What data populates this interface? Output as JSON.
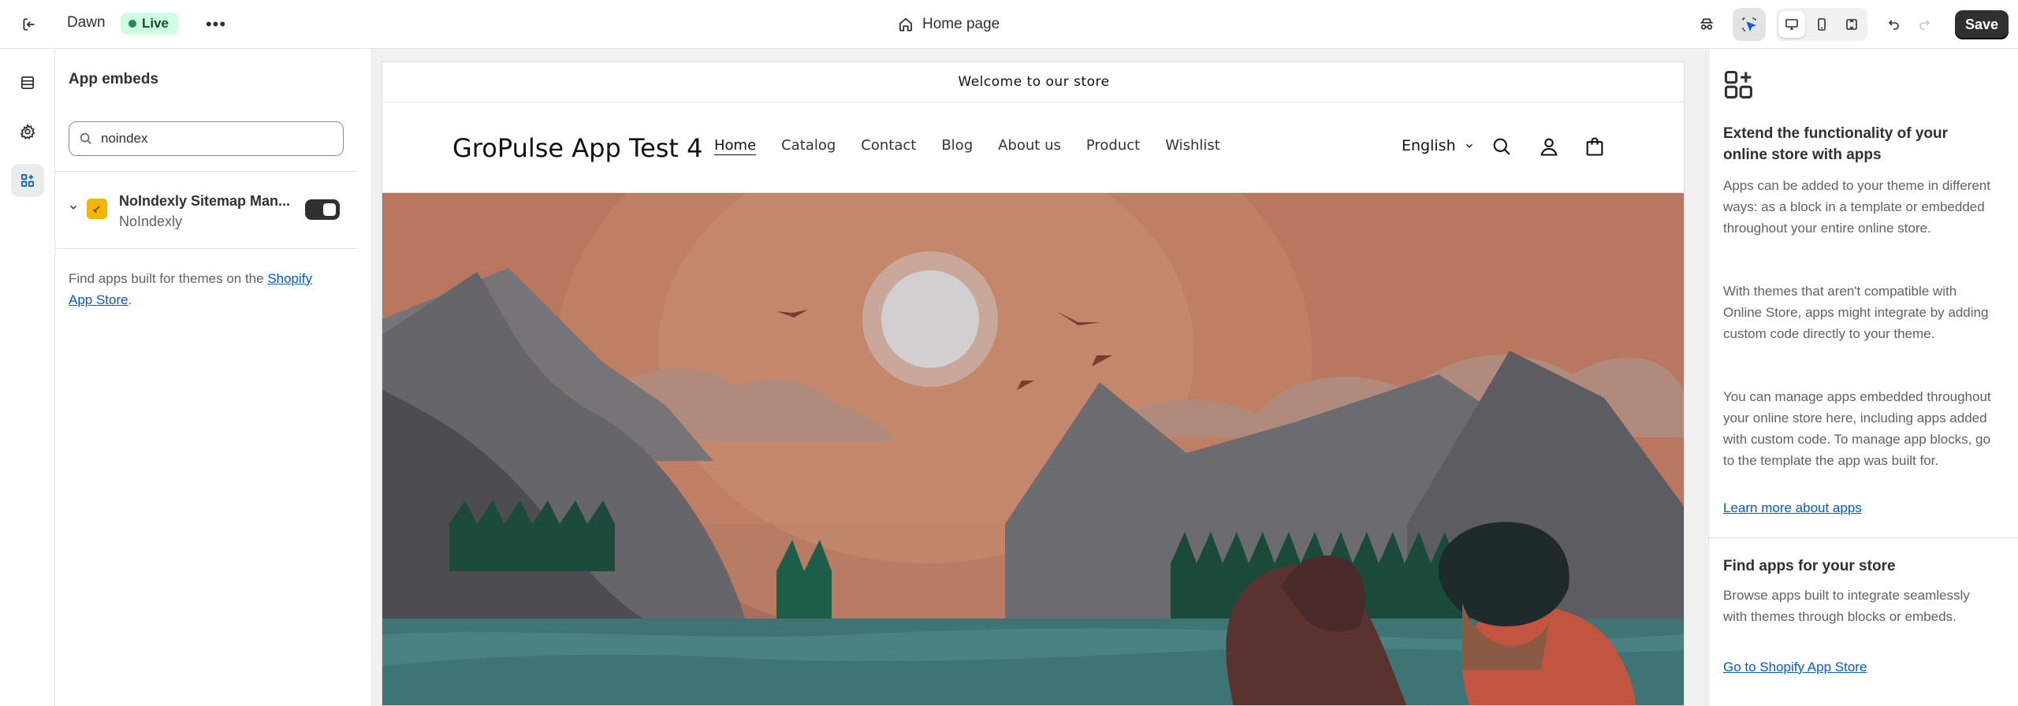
{
  "topbar": {
    "theme_name": "Dawn",
    "live_badge": "Live",
    "more_label": "•••",
    "page_selector": "Home page",
    "save_label": "Save"
  },
  "sidebar": {
    "title": "App embeds",
    "search_value": "noindex",
    "apps": [
      {
        "name": "NoIndexly Sitemap Man...",
        "vendor": "NoIndexly",
        "enabled": true
      }
    ],
    "footer_prefix": "Find apps built for themes on the ",
    "footer_link": "Shopify App Store",
    "footer_suffix": "."
  },
  "preview": {
    "announcement": "Welcome to our store",
    "store_name": "GroPulse App Test 4",
    "nav": [
      "Home",
      "Catalog",
      "Contact",
      "Blog",
      "About us",
      "Product",
      "Wishlist"
    ],
    "language": "English"
  },
  "right_panel": {
    "heading": "Extend the functionality of your online store with apps",
    "para1": "Apps can be added to your theme in different ways: as a block in a template or embedded throughout your entire online store.",
    "para2": "With themes that aren't compatible with Online Store, apps might integrate by adding custom code directly to your theme.",
    "para3": "You can manage apps embedded throughout your online store here, including apps added with custom code. To manage app blocks, go to the template the app was built for.",
    "learn_link": "Learn more about apps",
    "find_heading": "Find apps for your store",
    "find_para": "Browse apps built to integrate seamlessly with themes through blocks or embeds.",
    "find_link": "Go to Shopify App Store"
  },
  "colors": {
    "accent_dark": "#303030",
    "live_bg": "#cdfee1",
    "link": "#005bd3",
    "hero_sky": "#b9775f"
  }
}
